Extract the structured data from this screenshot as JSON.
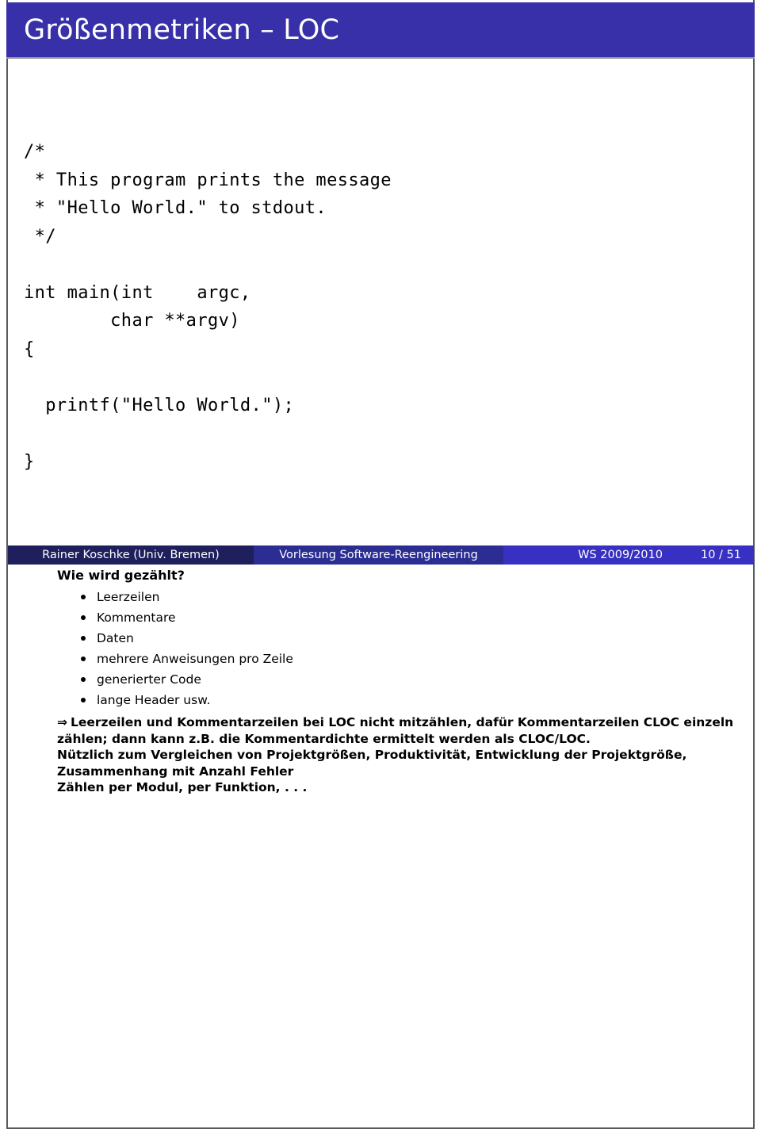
{
  "slide": {
    "title": "Größenmetriken – LOC",
    "accent_color": "#3730a8"
  },
  "code": {
    "language": "c",
    "lines": [
      "/*",
      " * This program prints the message",
      " * \"Hello World.\" to stdout.",
      " */",
      "",
      "int main(int    argc,",
      "        char **argv)",
      "{",
      "",
      "  printf(\"Hello World.\");",
      "",
      "}"
    ]
  },
  "footer": {
    "author": "Rainer Koschke  (Univ. Bremen)",
    "lecture": "Vorlesung Software-Reengineering",
    "term": "WS 2009/2010",
    "pages": "10 / 51",
    "author_bg": "#1e1f5c",
    "lecture_bg": "#2b2d93",
    "meta_bg": "#3730c2"
  },
  "content": {
    "lead": "Wie wird gezählt?",
    "bullets": [
      "Leerzeilen",
      "Kommentare",
      "Daten",
      "mehrere Anweisungen pro Zeile",
      "generierter Code",
      "lange Header usw."
    ],
    "arrow_glyph": "⇒",
    "paragraphs": [
      "Leerzeilen und Kommentarzeilen bei LOC nicht mitzählen, dafür Kommentarzeilen CLOC einzeln zählen; dann kann z.B. die Kommentardichte ermittelt werden als CLOC/LOC.",
      "Nützlich zum Vergleichen von Projektgrößen, Produktivität, Entwicklung der Projektgröße, Zusammenhang mit Anzahl Fehler",
      "Zählen per Modul, per Funktion, . . ."
    ]
  }
}
